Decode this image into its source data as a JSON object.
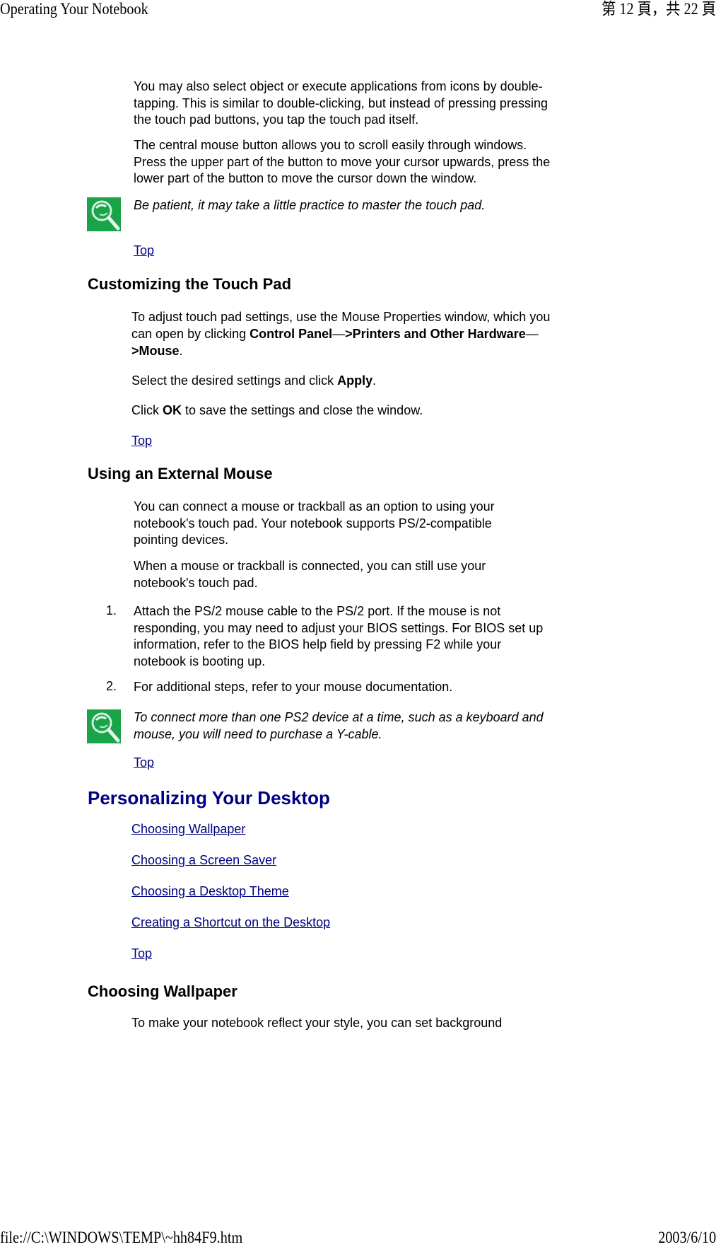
{
  "header": {
    "title": "Operating Your Notebook",
    "page_indicator": "第 12 頁，共 22 頁"
  },
  "footer": {
    "path": "file://C:\\WINDOWS\\TEMP\\~hh84F9.htm",
    "date": "2003/6/10"
  },
  "touchpad_intro": {
    "para1": "You may also select object or execute applications from icons by double-tapping. This is similar to double-clicking, but instead of pressing pressing the touch pad buttons, you tap the touch pad itself.",
    "para2": "The central mouse button allows you to scroll easily through windows. Press the upper part of the button to move your cursor upwards, press the lower part of the button to move the cursor down the window.",
    "note": "Be patient, it may take a little practice to master the touch pad.",
    "note_icon": "magnifier-note-icon",
    "top_link": "Top"
  },
  "customizing": {
    "heading": "Customizing the Touch Pad",
    "para1_prefix": "To adjust touch pad settings, use the Mouse Properties window, which you can open by clicking ",
    "para1_bold1": "Control Panel",
    "para1_arrow1": "—",
    "para1_bold2": ">Printers and Other Hardware",
    "para1_arrow2": "—",
    "para1_bold3": ">Mouse",
    "para1_suffix": ".",
    "para2_prefix": "Select the desired settings and click ",
    "para2_bold": "Apply",
    "para2_suffix": ".",
    "para3_prefix": "Click ",
    "para3_bold": "OK",
    "para3_suffix": " to save the settings and close the window.",
    "top_link": "Top"
  },
  "external_mouse": {
    "heading": "Using an External Mouse",
    "para1": "You can connect a mouse or trackball as an option to using your notebook's touch pad. Your notebook supports PS/2-compatible pointing devices.",
    "para2": "When a mouse or trackball is connected, you can still use your notebook's touch pad.",
    "steps": [
      {
        "num": "1.",
        "text": "Attach the PS/2 mouse cable to the PS/2 port. If the mouse is not responding, you may need to adjust your BIOS settings. For BIOS set up information, refer to the BIOS help field by pressing F2 while your notebook is booting up."
      },
      {
        "num": "2.",
        "text": "For additional steps, refer to your mouse documentation."
      }
    ],
    "note": "To connect more than one PS2 device at a time, such as a keyboard and mouse, you will need to purchase a Y-cable.",
    "top_link": "Top"
  },
  "personalizing": {
    "heading": "Personalizing Your Desktop",
    "links": [
      "Choosing Wallpaper",
      "Choosing a Screen Saver",
      "Choosing a Desktop Theme",
      "Creating a Shortcut on the Desktop"
    ],
    "top_link": "Top"
  },
  "wallpaper": {
    "heading": "Choosing Wallpaper",
    "para1": "To make your notebook reflect your style, you can set background"
  },
  "colors": {
    "link": "#000080",
    "heading_blue": "#000080",
    "icon_green": "#1aa44a"
  }
}
